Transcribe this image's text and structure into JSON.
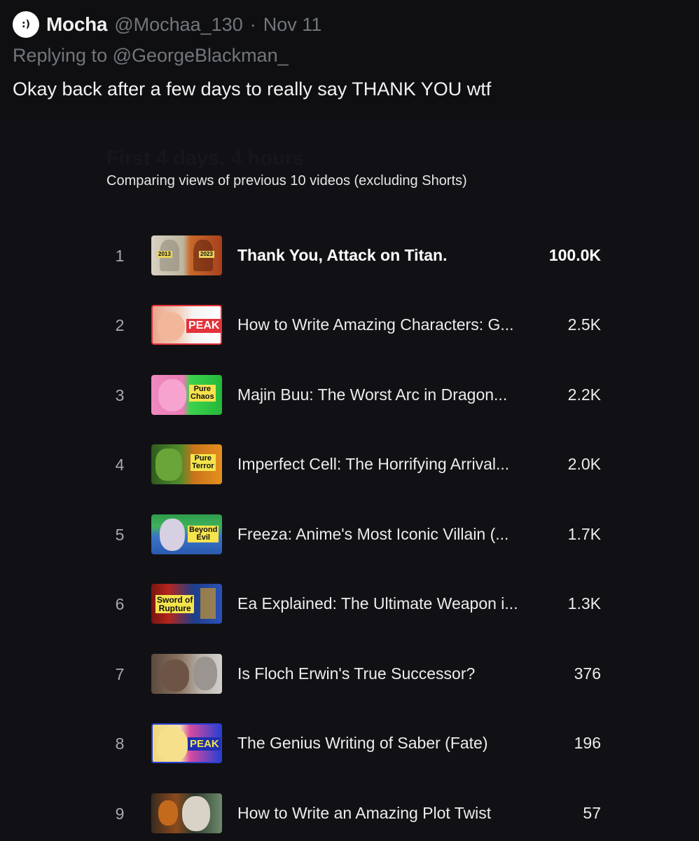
{
  "tweet": {
    "avatar_text": ":)",
    "display_name": "Mocha",
    "handle": "@Mochaa_130",
    "separator": "·",
    "date": "Nov 11",
    "replying_to": "Replying to @GeorgeBlackman_",
    "text": "Okay back after a few days to really say THANK YOU wtf"
  },
  "embed": {
    "title": "First 4 days, 4 hours",
    "subtitle": "Comparing views of previous 10 videos (excluding Shorts)",
    "videos": [
      {
        "rank": "1",
        "title": "Thank You, Attack on Titan.",
        "views": "100.0K",
        "thumb_tag": "2013 · 2023",
        "thumb_icon": "attack-on-titan-thumbnail"
      },
      {
        "rank": "2",
        "title": "How to Write Amazing Characters: G...",
        "views": "2.5K",
        "thumb_tag": "PEAK",
        "thumb_icon": "characters-thumbnail"
      },
      {
        "rank": "3",
        "title": "Majin Buu: The Worst Arc in Dragon...",
        "views": "2.2K",
        "thumb_tag": "Pure Chaos",
        "thumb_icon": "majin-buu-thumbnail"
      },
      {
        "rank": "4",
        "title": "Imperfect Cell: The Horrifying Arrival...",
        "views": "2.0K",
        "thumb_tag": "Pure Terror",
        "thumb_icon": "imperfect-cell-thumbnail"
      },
      {
        "rank": "5",
        "title": "Freeza: Anime's Most Iconic Villain (...",
        "views": "1.7K",
        "thumb_tag": "Beyond Evil",
        "thumb_icon": "freeza-thumbnail"
      },
      {
        "rank": "6",
        "title": "Ea Explained: The Ultimate Weapon i...",
        "views": "1.3K",
        "thumb_tag": "Sword of Rupture",
        "thumb_icon": "ea-thumbnail"
      },
      {
        "rank": "7",
        "title": "Is Floch Erwin's True Successor?",
        "views": "376",
        "thumb_tag": "",
        "thumb_icon": "floch-thumbnail"
      },
      {
        "rank": "8",
        "title": "The Genius Writing of Saber (Fate)",
        "views": "196",
        "thumb_tag": "PEAK",
        "thumb_icon": "saber-thumbnail"
      },
      {
        "rank": "9",
        "title": "How to Write an Amazing Plot Twist",
        "views": "57",
        "thumb_tag": "",
        "thumb_icon": "plot-twist-thumbnail"
      }
    ]
  },
  "colors": {
    "background": "#0f0f12",
    "muted_text": "#71767b",
    "primary_text": "#e7e9ea"
  }
}
